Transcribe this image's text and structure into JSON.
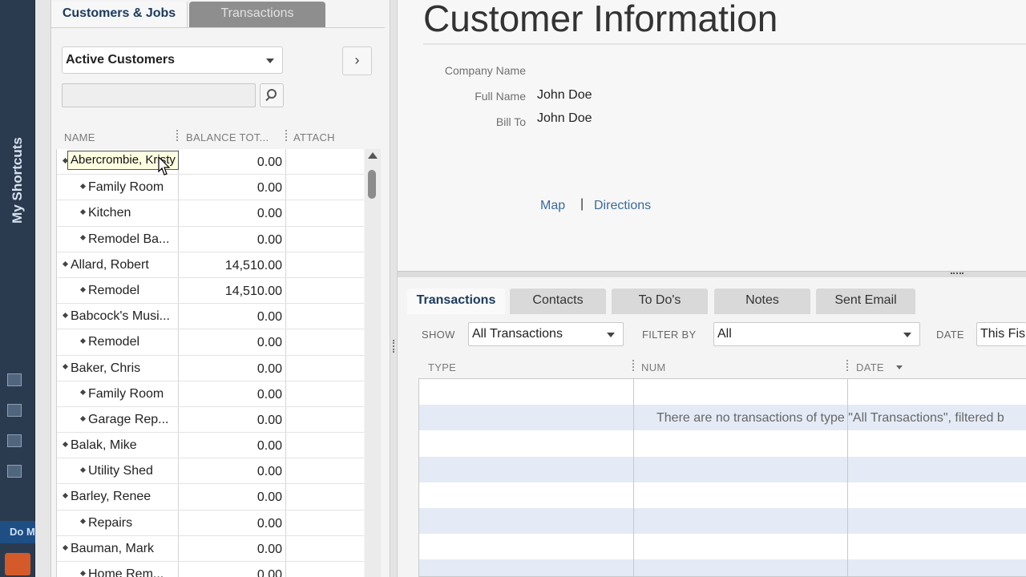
{
  "shortcuts": {
    "title": "My Shortcuts",
    "do_more": "Do M"
  },
  "left": {
    "tabs": [
      "Customers & Jobs",
      "Transactions"
    ],
    "view_select": "Active Customers",
    "columns": [
      "NAME",
      "BALANCE TOT...",
      "ATTACH"
    ],
    "tooltip": "Abercrombie, Kristy",
    "rows": [
      {
        "name": "",
        "balance": "0.00",
        "level": 0
      },
      {
        "name": "Family Room",
        "balance": "0.00",
        "level": 1
      },
      {
        "name": "Kitchen",
        "balance": "0.00",
        "level": 1
      },
      {
        "name": "Remodel Ba...",
        "balance": "0.00",
        "level": 1
      },
      {
        "name": "Allard, Robert",
        "balance": "14,510.00",
        "level": 0
      },
      {
        "name": "Remodel",
        "balance": "14,510.00",
        "level": 1
      },
      {
        "name": "Babcock's Musi...",
        "balance": "0.00",
        "level": 0
      },
      {
        "name": "Remodel",
        "balance": "0.00",
        "level": 1
      },
      {
        "name": "Baker, Chris",
        "balance": "0.00",
        "level": 0
      },
      {
        "name": "Family Room",
        "balance": "0.00",
        "level": 1
      },
      {
        "name": "Garage Rep...",
        "balance": "0.00",
        "level": 1
      },
      {
        "name": "Balak, Mike",
        "balance": "0.00",
        "level": 0
      },
      {
        "name": "Utility Shed",
        "balance": "0.00",
        "level": 1
      },
      {
        "name": "Barley, Renee",
        "balance": "0.00",
        "level": 0
      },
      {
        "name": "Repairs",
        "balance": "0.00",
        "level": 1
      },
      {
        "name": "Bauman, Mark",
        "balance": "0.00",
        "level": 0
      },
      {
        "name": "Home Rem...",
        "balance": "0.00",
        "level": 1
      }
    ]
  },
  "info": {
    "title": "Customer Information",
    "company_label": "Company Name",
    "company_value": "",
    "fullname_label": "Full Name",
    "fullname_value": "John  Doe",
    "billto_label": "Bill To",
    "billto_value": "John Doe",
    "map_link": "Map",
    "separator": "|",
    "directions_link": "Directions"
  },
  "transactions": {
    "tabs": [
      "Transactions",
      "Contacts",
      "To Do's",
      "Notes",
      "Sent Email"
    ],
    "show_label": "SHOW",
    "show_value": "All Transactions",
    "filter_label": "FILTER BY",
    "filter_value": "All",
    "date_label": "DATE",
    "date_value": "This Fis",
    "columns": [
      "TYPE",
      "NUM",
      "DATE"
    ],
    "empty_message": "There are no transactions of type \"All Transactions\", filtered b"
  }
}
